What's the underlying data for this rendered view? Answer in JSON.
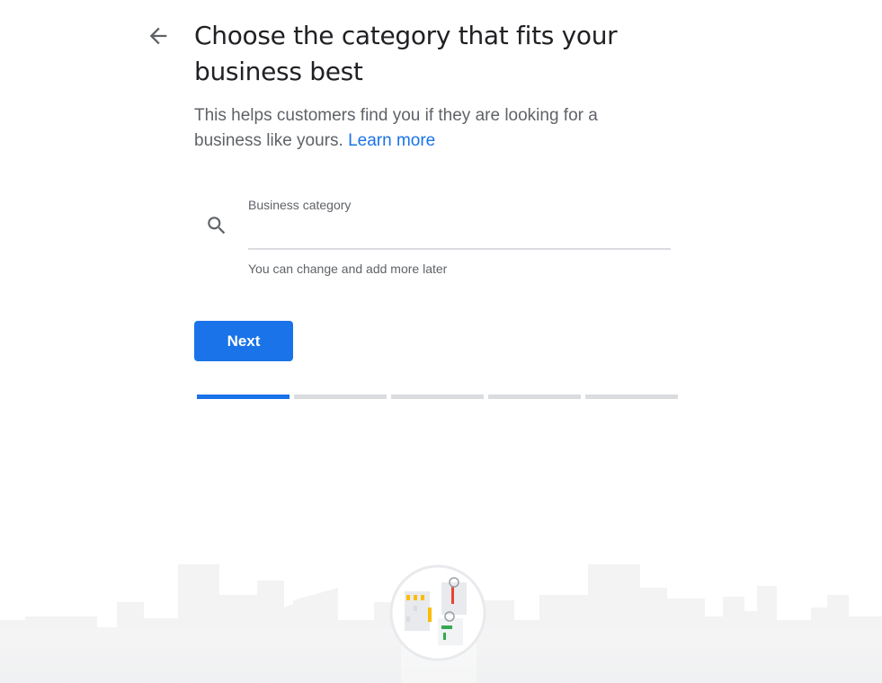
{
  "header": {
    "back_icon": "arrow-back-icon",
    "title": "Choose the category that fits your business best"
  },
  "description": {
    "text": "This helps customers find you if they are looking for a business like yours.",
    "link_label": "Learn more"
  },
  "category_field": {
    "icon": "search-icon",
    "label": "Business category",
    "value": "",
    "placeholder": "",
    "helper_text": "You can change and add more later"
  },
  "actions": {
    "next_label": "Next"
  },
  "progress": {
    "total_steps": 5,
    "current_step": 1
  },
  "colors": {
    "accent": "#1a73e8",
    "title_text": "#202124",
    "secondary_text": "#5f6368",
    "inactive_progress": "#dadce0"
  },
  "illustration": {
    "name": "business-storefront-illustration"
  }
}
